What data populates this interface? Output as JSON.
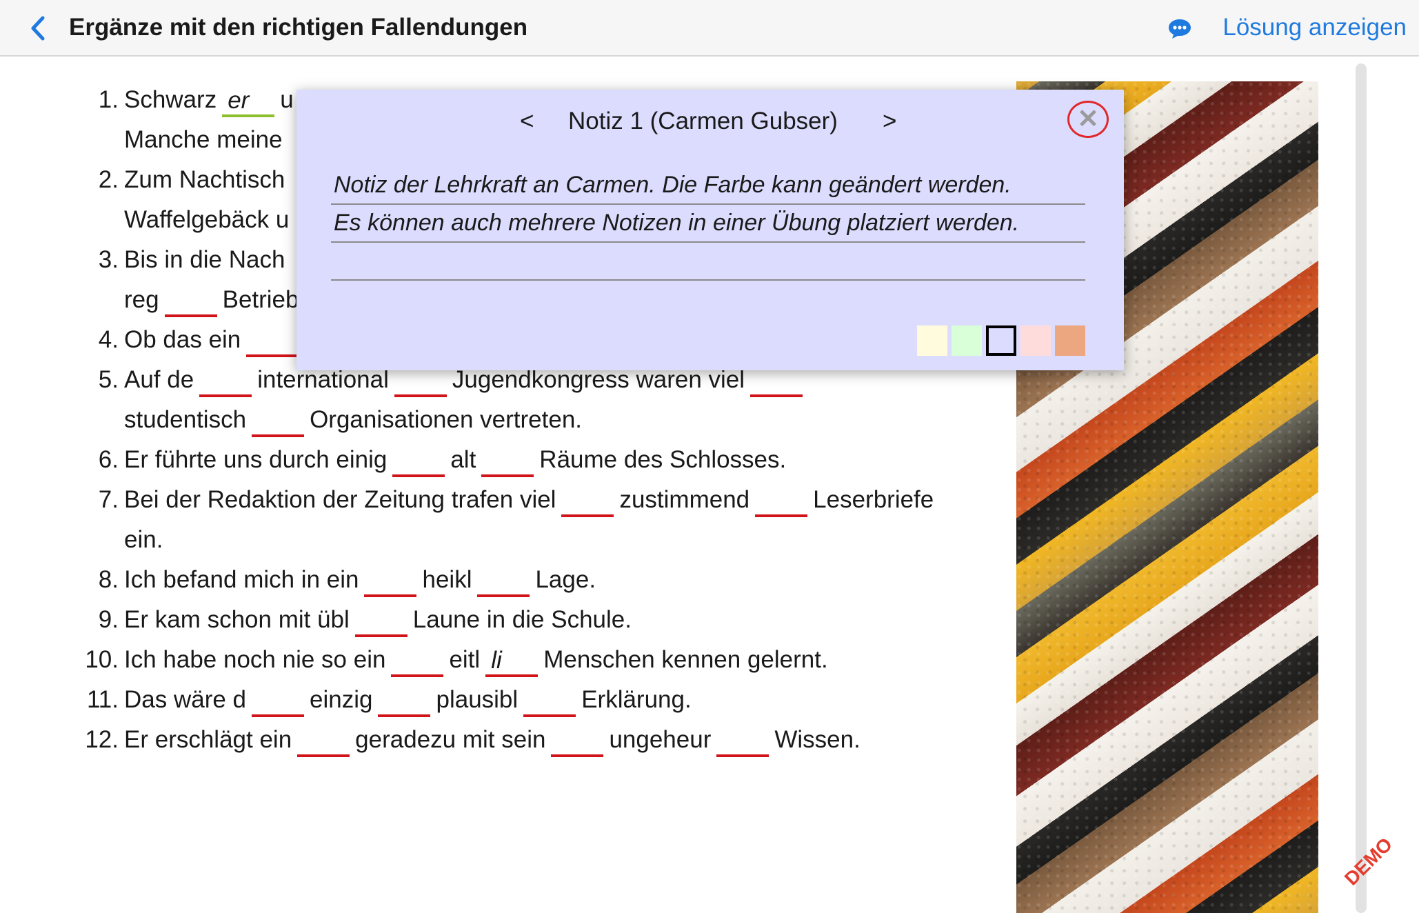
{
  "header": {
    "title": "Ergänze mit den richtigen Fallendungen",
    "solution_label": "Lösung anzeigen",
    "accent_color": "#1f7ae0"
  },
  "exercise": {
    "items": [
      {
        "number": "1.",
        "segments": [
          "Schwarz",
          "er",
          "u",
          "Manche meine"
        ]
      },
      {
        "number": "2.",
        "segments": [
          "Zum Nachtisch",
          "Waffelgebäck u"
        ]
      },
      {
        "number": "3.",
        "segments": [
          "Bis in die Nach",
          "reg",
          "Betrieb"
        ]
      },
      {
        "number": "4.",
        "segments": [
          "Ob das ein"
        ]
      },
      {
        "number": "5.",
        "segments": [
          "Auf de",
          "international",
          "Jugendkongress waren viel",
          "studentisch",
          "Organisationen vertreten."
        ]
      },
      {
        "number": "6.",
        "segments": [
          "Er führte uns durch einig",
          "alt",
          "Räume des Schlosses."
        ]
      },
      {
        "number": "7.",
        "segments": [
          "Bei der Redaktion der Zeitung trafen viel",
          "zustimmend",
          "Leserbriefe",
          "ein."
        ]
      },
      {
        "number": "8.",
        "segments": [
          "Ich befand mich in ein",
          "heikl",
          "Lage."
        ]
      },
      {
        "number": "9.",
        "segments": [
          "Er kam schon mit übl",
          "Laune in die Schule."
        ]
      },
      {
        "number": "10.",
        "segments": [
          "Ich habe noch nie so ein",
          "eitl",
          "li",
          "Menschen kennen gelernt."
        ]
      },
      {
        "number": "11.",
        "segments": [
          "Das wäre d",
          "einzig",
          "plausibl",
          "Erklärung."
        ]
      },
      {
        "number": "12.",
        "segments": [
          "Er erschlägt ein",
          "geradezu mit sein",
          "ungeheur",
          "Wissen."
        ]
      }
    ]
  },
  "note": {
    "prev_label": "<",
    "title": "Notiz 1 (Carmen Gubser)",
    "next_label": ">",
    "close_icon": "close-icon",
    "lines": [
      "Notiz der Lehrkraft an Carmen. Die Farbe kann geändert werden.",
      "Es können auch mehrere Notizen in einer Übung platziert werden.",
      ""
    ],
    "swatch_colors": [
      "#fffbdc",
      "#d8ffd8",
      "#dcdcff",
      "#ffdcdc",
      "#eca781"
    ],
    "selected_swatch": 2,
    "background": "#dcdcff"
  },
  "watermark": "DEMO"
}
